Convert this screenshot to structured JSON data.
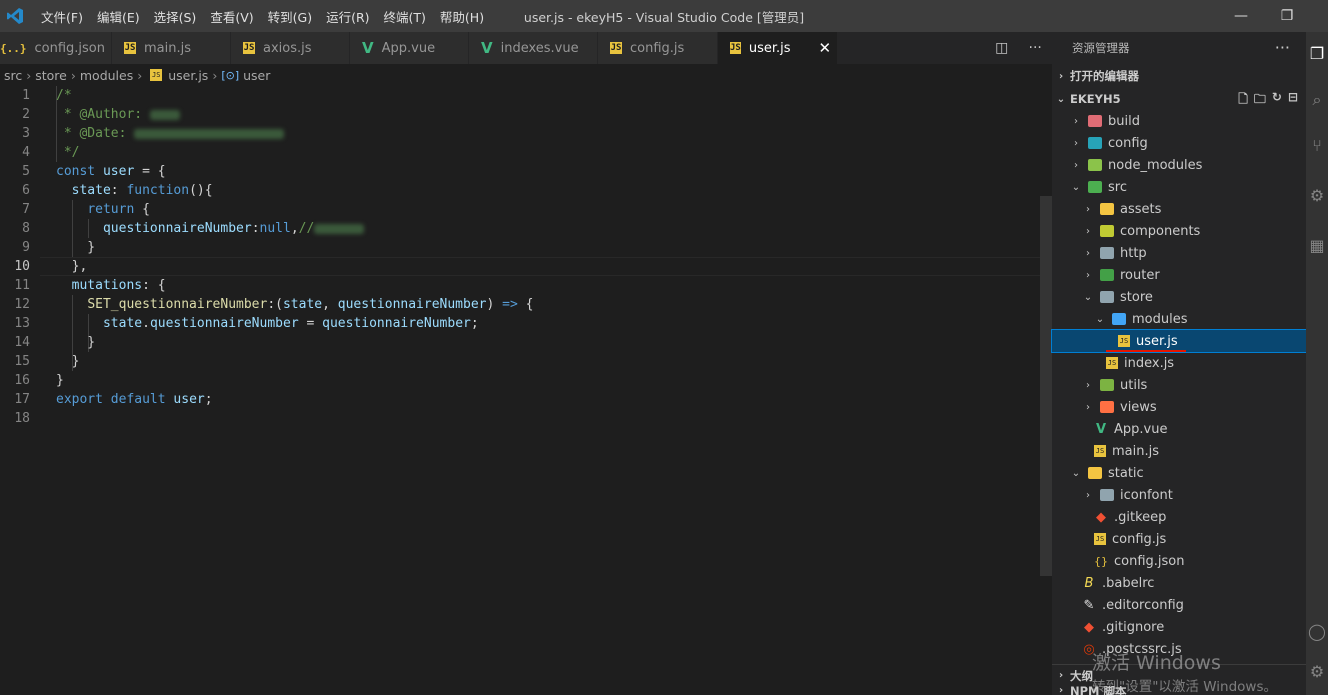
{
  "window": {
    "title": "user.js - ekeyH5 - Visual Studio Code [管理员]",
    "menus": [
      "文件(F)",
      "编辑(E)",
      "选择(S)",
      "查看(V)",
      "转到(G)",
      "运行(R)",
      "终端(T)",
      "帮助(H)"
    ]
  },
  "tabs": [
    {
      "label": "config.json",
      "icon": "json-icon"
    },
    {
      "label": "main.js",
      "icon": "js-icon"
    },
    {
      "label": "axios.js",
      "icon": "js-icon"
    },
    {
      "label": "App.vue",
      "icon": "vue-icon"
    },
    {
      "label": "indexes.vue",
      "icon": "vue-icon"
    },
    {
      "label": "config.js",
      "icon": "js-icon"
    },
    {
      "label": "user.js",
      "icon": "js-icon",
      "active": true
    }
  ],
  "breadcrumb": [
    "src",
    "store",
    "modules",
    "user.js",
    "user"
  ],
  "editor": {
    "current_line": 10,
    "lines": [
      "/*",
      " * @Author: ",
      " * @Date: ",
      " */",
      "const user = {",
      "  state: function(){",
      "    return {",
      "      questionnaireNumber:null,//",
      "    }",
      "  },",
      "  mutations: {",
      "    SET_questionnaireNumber:(state, questionnaireNumber) => {",
      "      state.questionnaireNumber = questionnaireNumber;",
      "    }",
      "  }",
      "}",
      "export default user;",
      ""
    ]
  },
  "sidebar": {
    "title": "资源管理器",
    "open_editors_label": "打开的编辑器",
    "project_label": "EKEYH5",
    "outline_label": "大纲",
    "npm_label": "NPM 脚本",
    "tree": [
      {
        "label": "build",
        "depth": 0,
        "type": "folder",
        "expanded": false,
        "color": "#e06c75"
      },
      {
        "label": "config",
        "depth": 0,
        "type": "folder",
        "expanded": false,
        "color": "#27a3b8"
      },
      {
        "label": "node_modules",
        "depth": 0,
        "type": "folder",
        "expanded": false,
        "color": "#8bc34a"
      },
      {
        "label": "src",
        "depth": 0,
        "type": "folder",
        "expanded": true,
        "color": "#4caf50"
      },
      {
        "label": "assets",
        "depth": 1,
        "type": "folder",
        "expanded": false,
        "color": "#f4c542"
      },
      {
        "label": "components",
        "depth": 1,
        "type": "folder",
        "expanded": false,
        "color": "#c0ca33"
      },
      {
        "label": "http",
        "depth": 1,
        "type": "folder",
        "expanded": false,
        "color": "#90a4ae"
      },
      {
        "label": "router",
        "depth": 1,
        "type": "folder",
        "expanded": false,
        "color": "#43a047"
      },
      {
        "label": "store",
        "depth": 1,
        "type": "folder",
        "expanded": true,
        "color": "#90a4ae"
      },
      {
        "label": "modules",
        "depth": 2,
        "type": "folder",
        "expanded": true,
        "color": "#42a5f5"
      },
      {
        "label": "user.js",
        "depth": 3,
        "type": "js",
        "selected": true
      },
      {
        "label": "index.js",
        "depth": 2,
        "type": "js"
      },
      {
        "label": "utils",
        "depth": 1,
        "type": "folder",
        "expanded": false,
        "color": "#7cb342"
      },
      {
        "label": "views",
        "depth": 1,
        "type": "folder",
        "expanded": false,
        "color": "#ff7043"
      },
      {
        "label": "App.vue",
        "depth": 1,
        "type": "vue"
      },
      {
        "label": "main.js",
        "depth": 1,
        "type": "js"
      },
      {
        "label": "static",
        "depth": 0,
        "type": "folder",
        "expanded": true,
        "color": "#f4c542"
      },
      {
        "label": "iconfont",
        "depth": 1,
        "type": "folder",
        "expanded": false,
        "color": "#90a4ae"
      },
      {
        "label": ".gitkeep",
        "depth": 1,
        "type": "git"
      },
      {
        "label": "config.js",
        "depth": 1,
        "type": "js"
      },
      {
        "label": "config.json",
        "depth": 1,
        "type": "json"
      },
      {
        "label": ".babelrc",
        "depth": 0,
        "type": "babel"
      },
      {
        "label": ".editorconfig",
        "depth": 0,
        "type": "editorconfig"
      },
      {
        "label": ".gitignore",
        "depth": 0,
        "type": "git"
      },
      {
        "label": ".postcssrc.js",
        "depth": 0,
        "type": "postcss"
      }
    ]
  },
  "watermark": {
    "line1": "激活 Windows",
    "line2": "转到\"设置\"以激活 Windows。"
  },
  "colors": {
    "titlebar": "#3c3c3c",
    "editor_bg": "#1e1e1e",
    "sidebar_bg": "#252526",
    "selection": "#094771",
    "js_icon": "#e8c33e",
    "vue_icon": "#41b883"
  }
}
